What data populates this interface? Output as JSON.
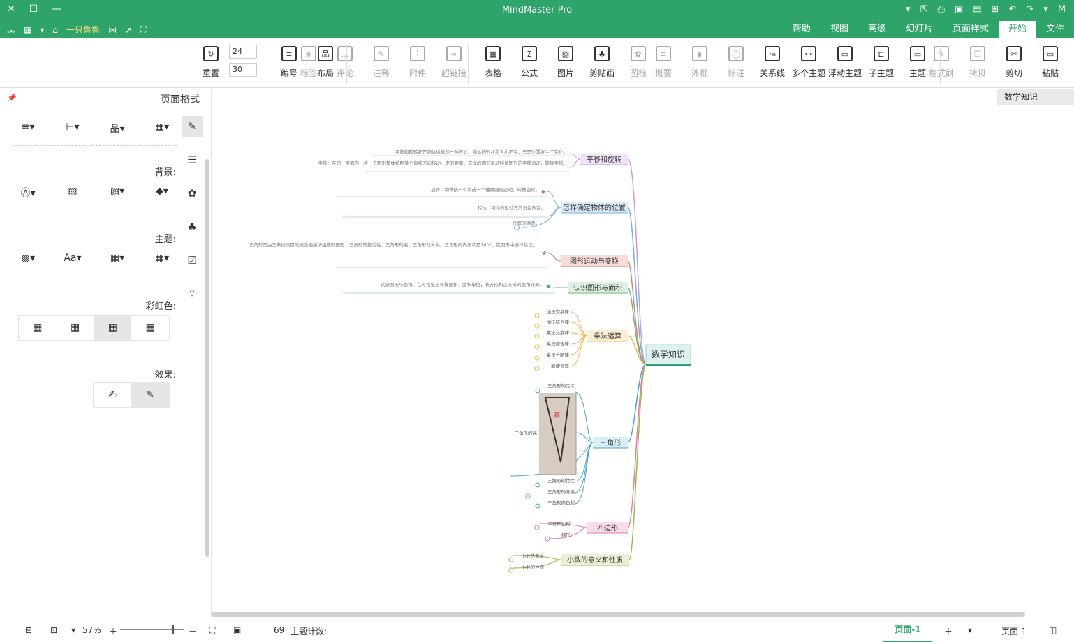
{
  "window": {
    "title": "MindMaster Pro",
    "controls": [
      "×",
      "□",
      "—"
    ],
    "right_icons": [
      "mindmaster-logo",
      "menu-chevron",
      "redo",
      "undo",
      "new",
      "open",
      "save",
      "print",
      "export",
      "more"
    ]
  },
  "quickbar": {
    "user": "一只鲁鲁",
    "icons": [
      "expand",
      "apps",
      "skin",
      "share",
      "publish",
      "fullscreen"
    ]
  },
  "tabs": [
    {
      "label": "文件",
      "active": false
    },
    {
      "label": "开始",
      "active": true
    },
    {
      "label": "页面样式",
      "active": false
    },
    {
      "label": "幻灯片",
      "active": false
    },
    {
      "label": "高级",
      "active": false
    },
    {
      "label": "视图",
      "active": false
    },
    {
      "label": "帮助",
      "active": false
    }
  ],
  "ribbon": {
    "clipboard": [
      "粘贴",
      "剪切",
      "拷贝",
      "格式刷"
    ],
    "insert": [
      "主题",
      "子主题",
      "浮动主题",
      "多个主题",
      "关系线",
      "标注",
      "外框",
      "概要",
      "图标",
      "剪贴画",
      "图片",
      "公式",
      "表格",
      "超链接",
      "附件",
      "注释",
      "评论",
      "标签"
    ],
    "layout": [
      "布局",
      "编号"
    ],
    "spacing": {
      "h": "24",
      "v": "30"
    },
    "reset": "重置"
  },
  "doc_tab": "数学知识",
  "panel": {
    "title": "页面格式",
    "background_label": "背景:",
    "theme_label": "主题:",
    "rainbow_label": "彩虹色:",
    "effect_label": "效果:"
  },
  "status": {
    "topic_count_label": "主题计数:",
    "topic_count": "69",
    "zoom": "57%",
    "page_label": "页面-1",
    "page_tab": "页面-1"
  },
  "mindmap": {
    "root": "数学知识",
    "branches": [
      {
        "label": "平移和旋转",
        "color": "#c79ad9"
      },
      {
        "label": "怎样确定物体的位置",
        "color": "#6fb0e0"
      },
      {
        "label": "图形运动与变换",
        "color": "#e07a6f"
      },
      {
        "label": "认识图形与面积",
        "color": "#6fb87a"
      },
      {
        "label": "乘法运算",
        "color": "#f0b54a"
      },
      {
        "label": "三角形",
        "color": "#4aa3c9"
      },
      {
        "label": "四边形",
        "color": "#e07ab0"
      },
      {
        "label": "小数的意义和性质",
        "color": "#9ab84a"
      }
    ],
    "notes": [
      "平移和旋转都是物体运动的一种方式，物体的形状和大小不变，只是位置发生了变化。",
      "平移：在同一平面内，将一个图形整体按照某个直线方向移动一定的距离，这样的图形运动叫做图形的平移运动，简称平移。",
      "旋转：物体绕一个点或一个轴做圆周运动，叫做旋转。",
      "转动：物体的运动方向发生改变。",
      "位置的确定。",
      "三角形是由三条线段首尾顺次相接所组成的图形，三角形的稳定性，三角形的高，三角形的分类。三角形的内角和是180°，在图形中进行验证。",
      "认识图形与面积，在方格纸上计算面积，面积单位，长方形和正方形的面积计算。"
    ],
    "multiply_leaves": [
      "加法交换律",
      "加法结合律",
      "乘法交换律",
      "乘法结合律",
      "乘法分配律",
      "简便运算"
    ],
    "triangle_leaves": [
      "三角形的定义",
      "三角形的高",
      "三角形的特性",
      "三角形的分类",
      "三角形内角和"
    ],
    "quad_leaves": [
      "平行四边形",
      "梯形"
    ],
    "decimal_leaves": [
      "小数的意义",
      "小数的性质"
    ]
  }
}
